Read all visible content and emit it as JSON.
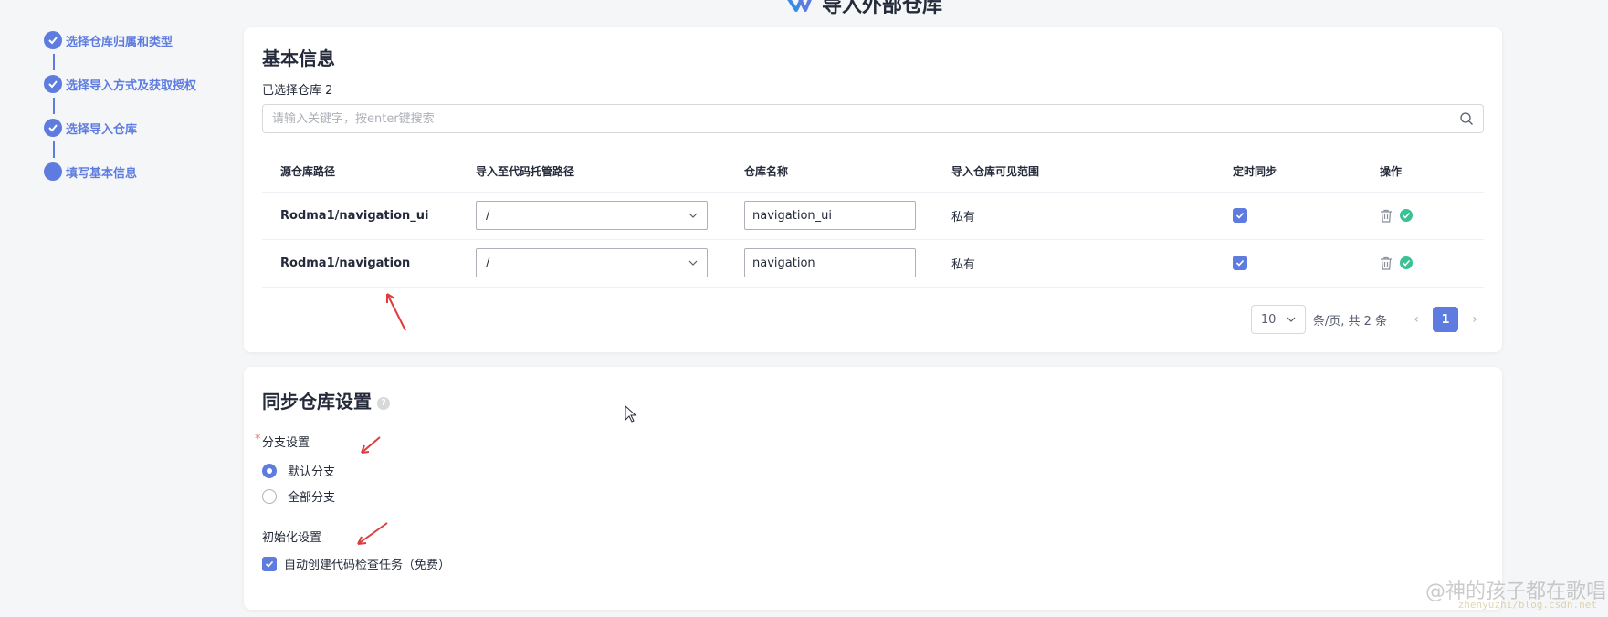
{
  "page": {
    "title": "导入外部仓库"
  },
  "steps": [
    {
      "label": "选择仓库归属和类型",
      "done": true
    },
    {
      "label": "选择导入方式及获取授权",
      "done": true
    },
    {
      "label": "选择导入仓库",
      "done": true
    },
    {
      "label": "填写基本信息",
      "done": false
    }
  ],
  "basic": {
    "title": "基本信息",
    "selected_text": "已选择仓库 2",
    "search_placeholder": "请输入关键字，按enter键搜索",
    "columns": [
      "源仓库路径",
      "导入至代码托管路径",
      "仓库名称",
      "导入仓库可见范围",
      "定时同步",
      "操作"
    ],
    "rows": [
      {
        "source": "Rodma1/navigation_ui",
        "target_path": "/",
        "name": "navigation_ui",
        "visibility": "私有",
        "sync": true
      },
      {
        "source": "Rodma1/navigation",
        "target_path": "/",
        "name": "navigation",
        "visibility": "私有",
        "sync": true
      }
    ],
    "pagination": {
      "page_size": "10",
      "summary": "条/页, 共 2 条",
      "current_page": "1"
    }
  },
  "sync": {
    "title": "同步仓库设置",
    "branch_label": "分支设置",
    "branch_options": [
      {
        "label": "默认分支",
        "selected": true
      },
      {
        "label": "全部分支",
        "selected": false
      }
    ],
    "init_label": "初始化设置",
    "init_option": {
      "label": "自动创建代码检查任务（免费）",
      "checked": true
    }
  },
  "watermark": {
    "text": "@神的孩子都在歌唱",
    "sub": "zhenyuzhi/blog.csdn.net"
  },
  "colors": {
    "primary": "#5e7ce0",
    "success": "#3ac295",
    "arrow": "#e03c3c"
  }
}
